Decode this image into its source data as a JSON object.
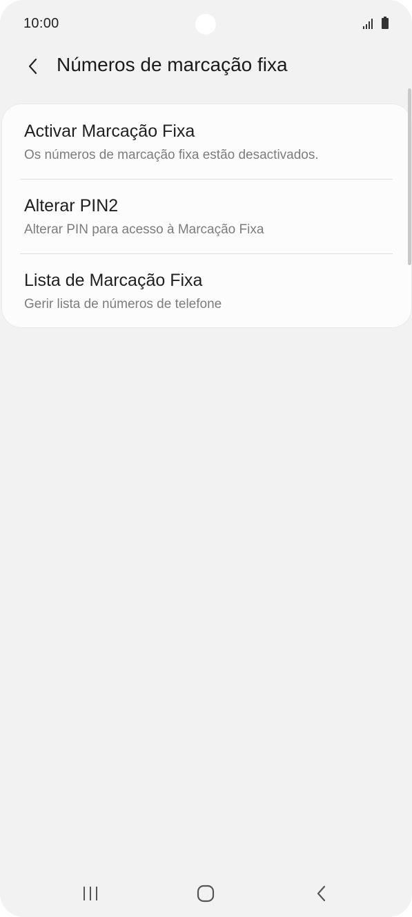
{
  "status_bar": {
    "time": "10:00",
    "signal_icon": "signal-icon",
    "battery_icon": "battery-icon"
  },
  "header": {
    "back_icon": "chevron-left-icon",
    "title": "Números de marcação fixa"
  },
  "settings": {
    "items": [
      {
        "title": "Activar Marcação Fixa",
        "subtitle": "Os números de marcação fixa estão desactivados."
      },
      {
        "title": "Alterar PIN2",
        "subtitle": "Alterar PIN para acesso à Marcação Fixa"
      },
      {
        "title": "Lista de Marcação Fixa",
        "subtitle": "Gerir lista de números de telefone"
      }
    ]
  },
  "nav_bar": {
    "recents_icon": "recents-icon",
    "home_icon": "home-icon",
    "back_icon": "back-icon"
  },
  "colors": {
    "background": "#f2f2f2",
    "card": "#fcfcfc",
    "title_text": "#1f1f1f",
    "subtitle_text": "#7c7c7c"
  }
}
